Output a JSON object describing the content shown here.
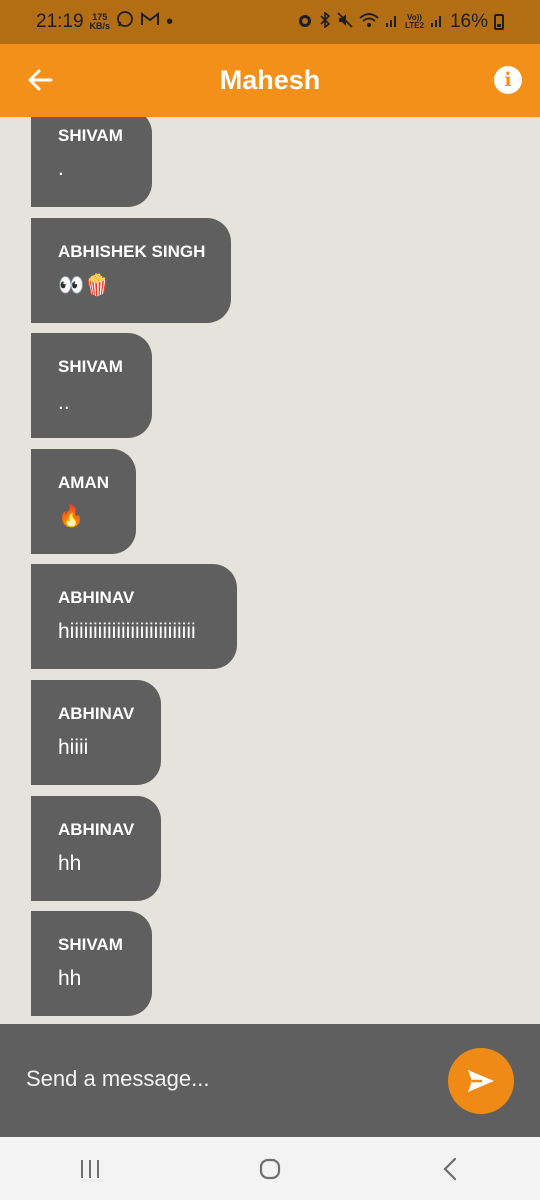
{
  "status_bar": {
    "time": "21:19",
    "net_speed_value": "175",
    "net_speed_unit": "KB/s",
    "notif_dot": "•",
    "volte_top": "Vo))",
    "volte_bottom": "LTE2",
    "battery_pct": "16%"
  },
  "header": {
    "title": "Mahesh",
    "info_glyph": "i"
  },
  "messages": [
    {
      "sender": "SHIVAM",
      "text": "."
    },
    {
      "sender": "ABHISHEK SINGH",
      "text": "👀🍿"
    },
    {
      "sender": "SHIVAM",
      "text": ".."
    },
    {
      "sender": "AMAN",
      "text": "🔥"
    },
    {
      "sender": "ABHINAV",
      "text": "hiiiiiiiiiiiiiiiiiiiiiiiiiii"
    },
    {
      "sender": "ABHINAV",
      "text": "hiiii"
    },
    {
      "sender": "ABHINAV",
      "text": "hh"
    },
    {
      "sender": "SHIVAM",
      "text": "hh"
    }
  ],
  "composer": {
    "placeholder": "Send a message..."
  },
  "colors": {
    "header": "#f2901a",
    "status_bar": "#b36d12",
    "bubble": "#5f5f5f",
    "background": "#e6e3dd",
    "send_button": "#ef8a16"
  },
  "icons": {
    "back": "arrow-left-icon",
    "info": "info-icon",
    "send": "send-icon",
    "nav_recents": "recents-icon",
    "nav_home": "home-icon",
    "nav_back": "chevron-left-icon"
  }
}
